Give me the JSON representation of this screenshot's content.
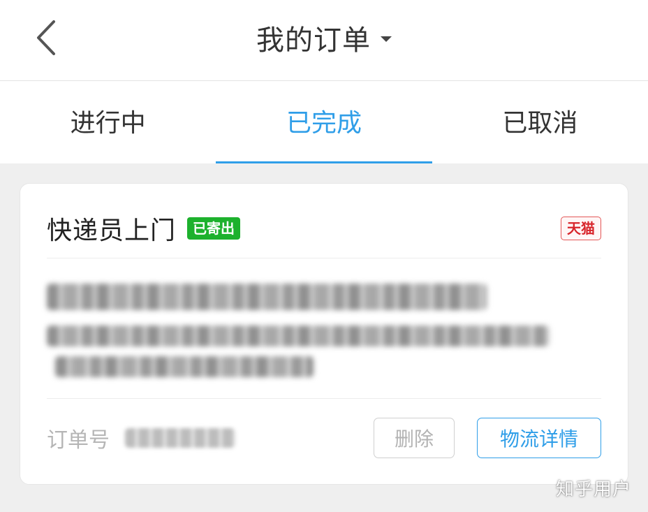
{
  "header": {
    "back_icon": "chevron-left-icon",
    "title": "我的订单",
    "title_caret_icon": "caret-down-icon"
  },
  "tabs": [
    {
      "label": "进行中",
      "active": false
    },
    {
      "label": "已完成",
      "active": true
    },
    {
      "label": "已取消",
      "active": false
    }
  ],
  "order_card": {
    "service_title": "快递员上门",
    "status_badge": "已寄出",
    "platform_badge": "天猫",
    "order_number_label": "订单号",
    "delete_button": "删除",
    "logistics_button": "物流详情"
  },
  "watermark": "知乎用户",
  "colors": {
    "accent": "#2f9ee8",
    "status_green": "#1db12d",
    "tmall_red": "#d8262c",
    "background": "#efefef"
  }
}
